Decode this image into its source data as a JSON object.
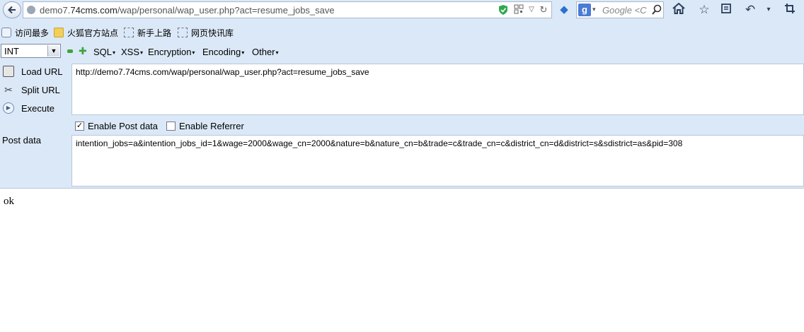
{
  "navbar": {
    "url_prefix": "demo7.",
    "url_domain": "74cms.com",
    "url_path": "/wap/personal/wap_user.php?act=resume_jobs_save",
    "search_placeholder": "Google <C"
  },
  "bookmarks": [
    {
      "label": "访问最多",
      "icon": "search-globe-icon"
    },
    {
      "label": "火狐官方站点",
      "icon": "folder-icon"
    },
    {
      "label": "新手上路",
      "icon": "dashed-page-icon"
    },
    {
      "label": "网页快讯库",
      "icon": "dashed-page-icon"
    }
  ],
  "hackbar": {
    "select_value": "INT",
    "menus": [
      "SQL",
      "XSS",
      "Encryption",
      "Encoding",
      "Other"
    ],
    "load_url": "Load URL",
    "split_url": "Split URL",
    "execute": "Execute",
    "url_value": "http://demo7.74cms.com/wap/personal/wap_user.php?act=resume_jobs_save",
    "enable_post": "Enable Post data",
    "enable_post_checked": true,
    "enable_referrer": "Enable Referrer",
    "enable_referrer_checked": false,
    "post_label": "Post data",
    "post_value": "intention_jobs=a&intention_jobs_id=1&wage=2000&wage_cn=2000&nature=b&nature_cn=b&trade=c&trade_cn=c&district_cn=d&district=s&sdistrict=as&pid=308"
  },
  "page": {
    "response_text": "ok"
  }
}
